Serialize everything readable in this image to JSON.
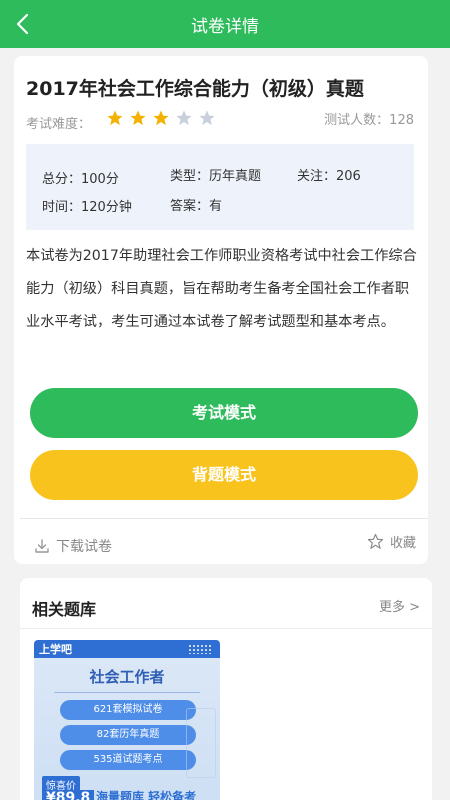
{
  "header": {
    "title": "试卷详情"
  },
  "paper": {
    "title": "2017年社会工作综合能力（初级）真题",
    "difficulty_label": "考试难度：",
    "difficulty_rating": 3,
    "difficulty_max": 5,
    "testers": "测试人数：128",
    "info": {
      "total": "总分：100分",
      "type": "类型：历年真题",
      "follow": "关注：206",
      "time": "时间：120分钟",
      "answer": "答案：有"
    },
    "description": "本试卷为2017年助理社会工作师职业资格考试中社会工作综合能力（初级）科目真题，旨在帮助考生备考全国社会工作者职业水平考试，考生可通过本试卷了解考试题型和基本考点。"
  },
  "actions": {
    "exam_mode": "考试模式",
    "memorize_mode": "背题模式",
    "download": "下载试卷",
    "favorite": "收藏"
  },
  "related": {
    "title": "相关题库",
    "more": "更多 >",
    "book": {
      "brand": "上学吧",
      "name": "社会工作者",
      "features": [
        "621套模拟试卷",
        "82套历年真题",
        "535道试题考点"
      ],
      "price_label": "惊喜价",
      "price": "¥89.8",
      "slogan": "海量题库 轻松备考"
    }
  },
  "colors": {
    "brand_green": "#2dbb5c",
    "accent_yellow": "#f8c31c",
    "star_on": "#f5b100",
    "star_off": "#c8d0dc"
  }
}
